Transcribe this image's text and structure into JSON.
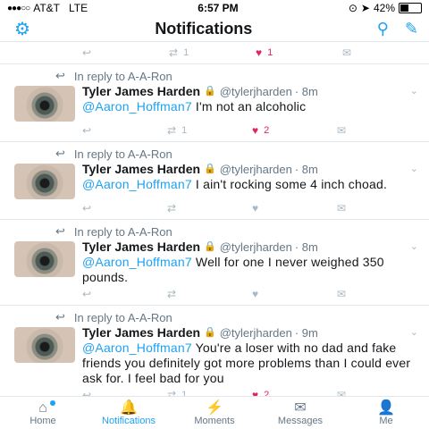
{
  "status": {
    "carrier": "AT&T",
    "network": "LTE",
    "time": "6:57 PM",
    "battery": "42%",
    "battery_level": 0.42
  },
  "header": {
    "title": "Notifications"
  },
  "top_actions": {
    "retweets": "1",
    "likes": "1"
  },
  "tweets": [
    {
      "reply_to": "In reply to A-A-Ron",
      "name": "Tyler James Harden",
      "handle": "@tylerjharden",
      "time": "· 8m",
      "mention": "@Aaron_Hoffman7",
      "text": " I'm not an alcoholic",
      "retweets": "1",
      "likes": "2"
    },
    {
      "reply_to": "In reply to A-A-Ron",
      "name": "Tyler James Harden",
      "handle": "@tylerjharden",
      "time": "· 8m",
      "mention": "@Aaron_Hoffman7",
      "text": " I ain't rocking some 4 inch choad.",
      "retweets": "",
      "likes": ""
    },
    {
      "reply_to": "In reply to A-A-Ron",
      "name": "Tyler James Harden",
      "handle": "@tylerjharden",
      "time": "· 8m",
      "mention": "@Aaron_Hoffman7",
      "text": " Well for one I never weighed 350 pounds.",
      "retweets": "",
      "likes": ""
    },
    {
      "reply_to": "In reply to A-A-Ron",
      "name": "Tyler James Harden",
      "handle": "@tylerjharden",
      "time": "· 9m",
      "mention": "@Aaron_Hoffman7",
      "text": " You're a loser with no dad and fake friends you definitely got more problems than I could ever ask for. I feel bad for you",
      "retweets": "1",
      "likes": "2"
    }
  ],
  "tabs": {
    "home": "Home",
    "notifications": "Notifications",
    "moments": "Moments",
    "messages": "Messages",
    "me": "Me"
  },
  "colors": {
    "accent": "#1da1f2",
    "like": "#e0245e",
    "muted": "#657786"
  }
}
